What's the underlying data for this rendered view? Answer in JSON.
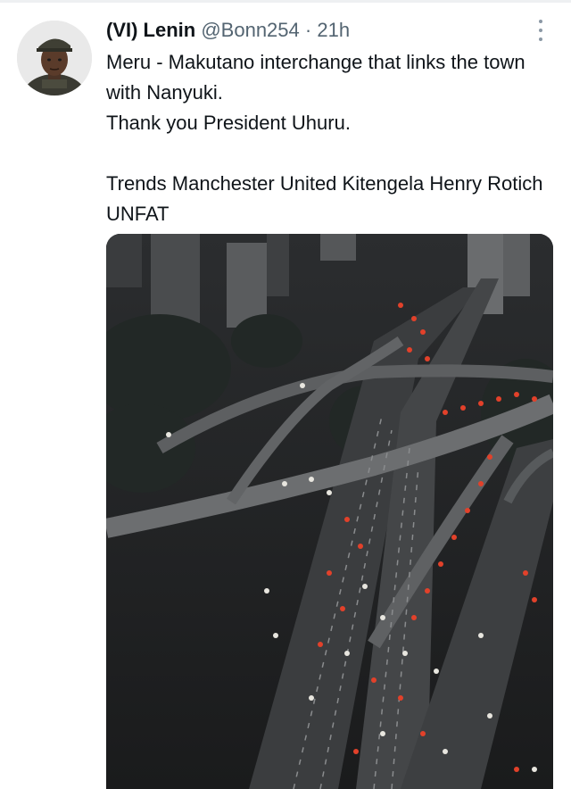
{
  "tweet": {
    "author_name": "(VI) Lenin",
    "handle": "@Bonn254",
    "separator": "·",
    "time": "21h",
    "lines": [
      "Meru - Makutano  interchange that links the town with Nanyuki.",
      "Thank you President Uhuru.",
      "",
      "Trends Manchester United Kitengela Henry Rotich UNFAT"
    ]
  },
  "icons": {
    "more": "more-vertical-icon",
    "avatar": "avatar-photo"
  },
  "colors": {
    "text": "#0f1419",
    "secondary": "#536471",
    "divider": "#eef0f2"
  }
}
